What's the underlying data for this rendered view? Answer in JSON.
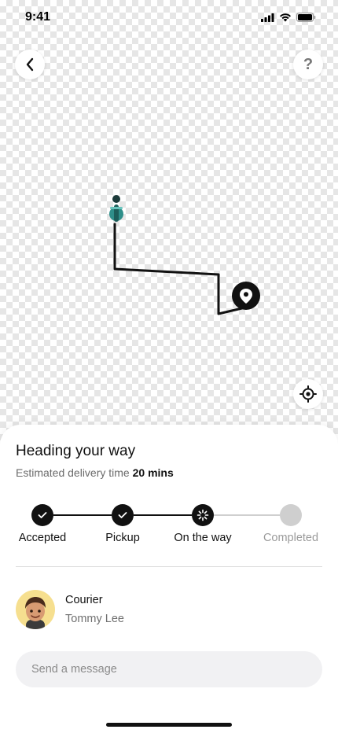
{
  "status_bar": {
    "time": "9:41"
  },
  "map": {
    "help_label": "?",
    "icons": {
      "back": "chevron-left-icon",
      "help": "question-icon",
      "locate": "crosshair-icon",
      "courier": "scooter-icon",
      "destination": "location-pin-icon"
    }
  },
  "delivery": {
    "title": "Heading your way",
    "eta_label": "Estimated delivery time",
    "eta_value": "20 mins",
    "steps": [
      {
        "label": "Accepted",
        "state": "done"
      },
      {
        "label": "Pickup",
        "state": "done"
      },
      {
        "label": "On the way",
        "state": "active"
      },
      {
        "label": "Completed",
        "state": "pending"
      }
    ]
  },
  "courier": {
    "role": "Courier",
    "name": "Tommy Lee"
  },
  "message": {
    "placeholder": "Send a message"
  },
  "colors": {
    "accent": "#111111",
    "pending": "#cfcfcf",
    "avatar_bg": "#f6df8f",
    "input_bg": "#f1f1f3"
  }
}
